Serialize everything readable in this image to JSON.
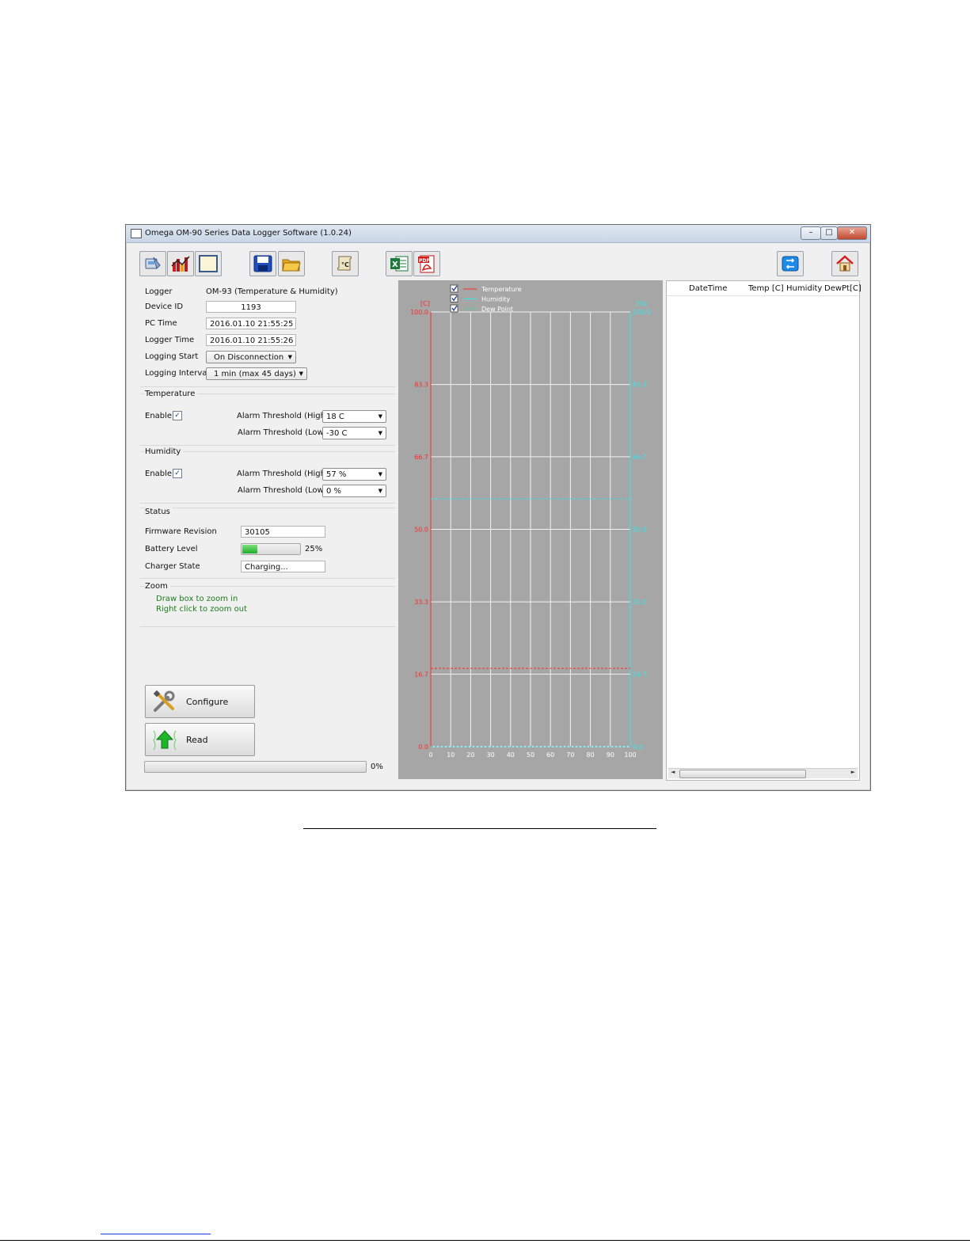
{
  "window": {
    "title": "Omega OM-90 Series Data Logger Software (1.0.24)"
  },
  "toolbar": {
    "left_icons": [
      "logger-device-icon",
      "bar-chart-icon",
      "blank-window-icon",
      "save-icon",
      "open-folder-icon",
      "celsius-scroll-icon",
      "excel-icon",
      "pdf-icon"
    ],
    "right_icons": [
      "refresh-icon",
      "home-icon"
    ],
    "pdf_badge": "PDF",
    "celsius_label": "°C"
  },
  "logger": {
    "logger_label": "Logger",
    "logger_value": "OM-93 (Temperature & Humidity)",
    "device_id_label": "Device ID",
    "device_id_value": "1193",
    "pc_time_label": "PC Time",
    "pc_time_value": "2016.01.10 21:55:25",
    "logger_time_label": "Logger Time",
    "logger_time_value": "2016.01.10 21:55:26",
    "logging_start_label": "Logging Start",
    "logging_start_value": "On Disconnection",
    "logging_interval_label": "Logging Interval",
    "logging_interval_value": "1 min (max 45 days)"
  },
  "temperature": {
    "title": "Temperature",
    "enable_label": "Enable",
    "enabled": true,
    "high_label": "Alarm Threshold (High)",
    "high_value": "18 C",
    "low_label": "Alarm Threshold (Low)",
    "low_value": "-30 C"
  },
  "humidity": {
    "title": "Humidity",
    "enable_label": "Enable",
    "enabled": true,
    "high_label": "Alarm Threshold (High)",
    "high_value": "57 %",
    "low_label": "Alarm Threshold (Low)",
    "low_value": "0 %"
  },
  "status": {
    "title": "Status",
    "firmware_label": "Firmware Revision",
    "firmware_value": "30105",
    "battery_label": "Battery Level",
    "battery_text": "25%",
    "battery_level": 0.25,
    "charger_label": "Charger State",
    "charger_value": "Charging..."
  },
  "zoom": {
    "title": "Zoom",
    "line1": "Draw box to zoom in",
    "line2": "Right click to zoom out"
  },
  "actions": {
    "configure_label": "Configure",
    "read_label": "Read",
    "progress_text": "0%",
    "progress": 0
  },
  "chart_data": {
    "type": "line",
    "series": [
      {
        "name": "Temperature",
        "color": "#ff2a2a",
        "checked": true,
        "values": []
      },
      {
        "name": "Humidity",
        "color": "#33e6ee",
        "checked": true,
        "values": []
      },
      {
        "name": "Dew Point",
        "color": "#58c98a",
        "checked": true,
        "values": []
      }
    ],
    "y_left_unit": "[C]",
    "y_right_unit": "[%]",
    "xlim": [
      0,
      100
    ],
    "ylim": [
      0,
      100
    ],
    "x_ticks": [
      "0",
      "10",
      "20",
      "30",
      "40",
      "50",
      "60",
      "70",
      "80",
      "90",
      "100"
    ],
    "y_ticks": [
      "0.0",
      "16.7",
      "33.3",
      "50.0",
      "66.7",
      "83.3",
      "100.0"
    ],
    "thresholds": [
      {
        "axis": "left",
        "value": 18,
        "color": "#ff2a2a",
        "style": "dashed"
      },
      {
        "axis": "right",
        "value": 57,
        "color": "#33e6ee",
        "style": "dashed"
      },
      {
        "axis": "right",
        "value": 0,
        "color": "#33e6ee",
        "style": "dashed"
      }
    ],
    "grid": true,
    "legend": "top-left"
  },
  "table": {
    "columns": [
      "DateTime",
      "Temp [C]",
      "Humidity",
      "DewPt[C]"
    ],
    "rows": []
  }
}
